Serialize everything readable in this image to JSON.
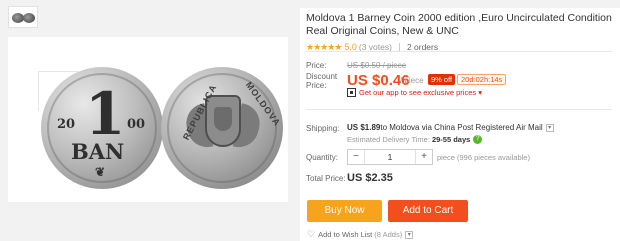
{
  "product": {
    "title": "Moldova 1 Barney Coin 2000 edition ,Euro Uncirculated Condition Real Original Coins, New & UNC",
    "stars": "★★★★★",
    "rating": "5.0",
    "votes": "(3 votes)",
    "orders": "2 orders"
  },
  "image": {
    "coin_one": "1",
    "coin_year_left": "20",
    "coin_year_right": "00",
    "coin_ban": "BAN",
    "arc_left": "REPUBLICA",
    "arc_right": "MOLDOVA"
  },
  "price": {
    "price_label": "Price:",
    "old_price": "US $0.50 / piece",
    "discount_label": "Discount Price:",
    "new_price": "US $0.46",
    "per_piece": "/ piece",
    "off_badge": "9% off",
    "timer": "20d:02h:14s",
    "app_promo": "Get our app to see exclusive prices ▾"
  },
  "shipping": {
    "label": "Shipping:",
    "cost": "US $1.89",
    "to_text": " to Moldova via China Post Registered Air Mail",
    "delivery_label": "Estimated Delivery Time:",
    "delivery_value": "29-55 days"
  },
  "quantity": {
    "label": "Quantity:",
    "minus": "−",
    "value": "1",
    "plus": "+",
    "note": "piece (996 pieces available)"
  },
  "total": {
    "label": "Total Price:",
    "value": "US $2.35"
  },
  "actions": {
    "buy_now": "Buy Now",
    "add_to_cart": "Add to Cart"
  },
  "wishlist": {
    "label": "Add to Wish List",
    "count": "(8 Adds)"
  },
  "colors": {
    "accent_orange": "#f7a31b",
    "accent_red": "#f24e1e",
    "badge_red": "#e62e04"
  }
}
